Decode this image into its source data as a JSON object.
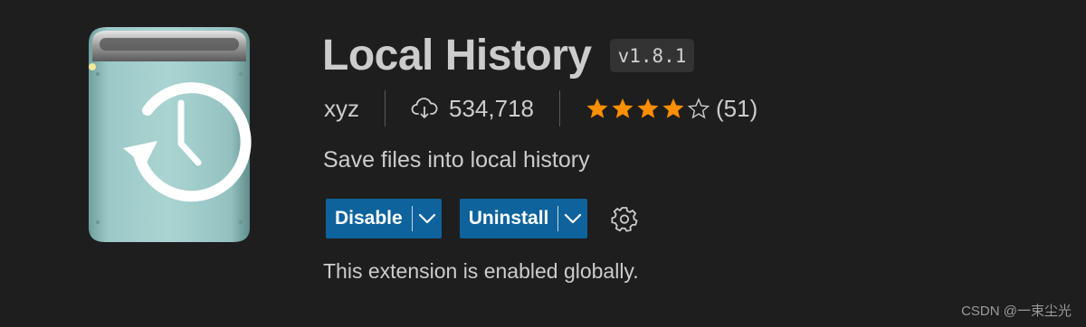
{
  "extension": {
    "icon": "time-machine-drive-icon",
    "name": "Local History",
    "version": "v1.8.1",
    "publisher": "xyz",
    "installs": "534,718",
    "installs_icon": "cloud-download-icon",
    "rating": {
      "stars": 4,
      "max_stars": 5,
      "count_label": "(51)"
    },
    "description": "Save files into local history"
  },
  "actions": {
    "disable_label": "Disable",
    "uninstall_label": "Uninstall",
    "dropdown_icon": "chevron-down-icon",
    "settings_icon": "gear-icon"
  },
  "status": "This extension is enabled globally.",
  "watermark": "CSDN @一束尘光",
  "colors": {
    "background": "#1e1e1e",
    "button": "#0e639c",
    "star": "#ff8e00",
    "text": "#cccccc"
  }
}
